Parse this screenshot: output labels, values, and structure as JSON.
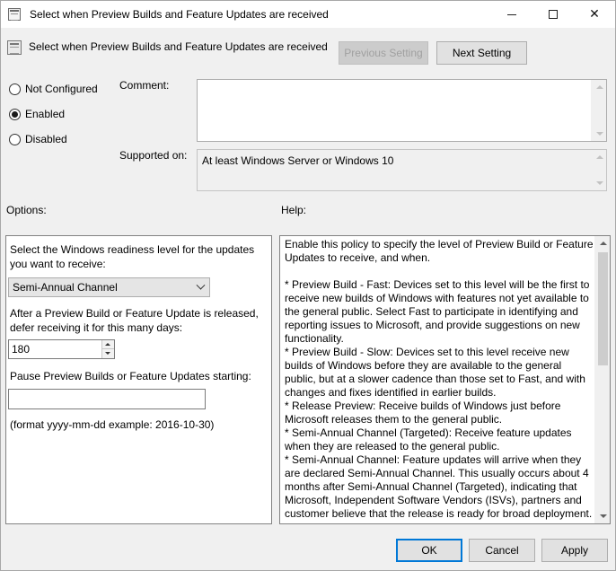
{
  "window": {
    "title": "Select when Preview Builds and Feature Updates are received",
    "minimize": "–",
    "maximize": "□",
    "close": "✕"
  },
  "header": {
    "policy_name": "Select when Preview Builds and Feature Updates are received",
    "previous_label": "Previous Setting",
    "next_label": "Next Setting"
  },
  "state": {
    "options": [
      "Not Configured",
      "Enabled",
      "Disabled"
    ],
    "selected": "Enabled"
  },
  "comment": {
    "label": "Comment:",
    "value": ""
  },
  "supported": {
    "label": "Supported on:",
    "value": "At least Windows Server or Windows 10"
  },
  "options": {
    "label": "Options:",
    "readiness_label": "Select the Windows readiness level for the updates you want to receive:",
    "readiness_value": "Semi-Annual Channel",
    "defer_label": "After a Preview Build or Feature Update is released, defer receiving it for this many days:",
    "defer_value": "180",
    "pause_label": "Pause Preview Builds or Feature Updates starting:",
    "pause_value": "",
    "format_hint": "(format yyyy-mm-dd example: 2016-10-30)"
  },
  "help": {
    "label": "Help:",
    "paragraphs": [
      "Enable this policy to specify the level of Preview Build or Feature Updates to receive, and when.",
      "",
      "* Preview Build - Fast: Devices set to this level will be the first to receive new builds of Windows with features not yet available to the general public. Select Fast to participate in identifying and reporting issues to Microsoft, and provide suggestions on new functionality.",
      "* Preview Build - Slow: Devices set to this level receive new builds of Windows before they are available to the general public, but at a slower cadence than those set to Fast, and with changes and fixes identified in earlier builds.",
      "* Release Preview: Receive builds of Windows just before Microsoft releases them to the general public.",
      "* Semi-Annual Channel (Targeted): Receive feature updates when they are released to the general public.",
      "* Semi-Annual Channel: Feature updates will arrive when they are declared Semi-Annual Channel. This usually occurs about 4 months after Semi-Annual Channel (Targeted), indicating that Microsoft, Independent Software Vendors (ISVs), partners and customer believe that the release is ready for broad deployment."
    ]
  },
  "footer": {
    "ok": "OK",
    "cancel": "Cancel",
    "apply": "Apply"
  },
  "colors": {
    "accent": "#0078d7",
    "dialog_bg": "#f0f0f0"
  }
}
